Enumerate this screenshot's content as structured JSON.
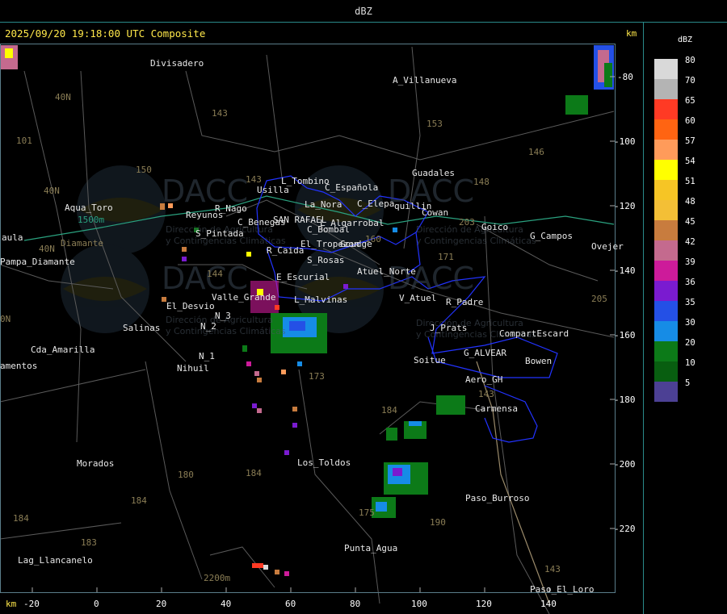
{
  "window": {
    "title": "dBZ"
  },
  "plot": {
    "header": "2025/09/20 19:18:00 UTC Composite",
    "y_unit": "km",
    "x_unit": "km",
    "y_ticks": [
      "-80",
      "-100",
      "-120",
      "-140",
      "-160",
      "-180",
      "-200",
      "-220"
    ],
    "x_ticks": [
      "-20",
      "0",
      "20",
      "40",
      "60",
      "80",
      "100",
      "120",
      "140"
    ]
  },
  "places": [
    {
      "id": "divisadero",
      "label": "Divisadero"
    },
    {
      "id": "a-villanueva",
      "label": "A_Villanueva"
    },
    {
      "id": "guadales",
      "label": "Guadales"
    },
    {
      "id": "l-tombino",
      "label": "L_Tombino"
    },
    {
      "id": "usilla",
      "label": "Usilla"
    },
    {
      "id": "c-espanola",
      "label": "C_Española"
    },
    {
      "id": "aqua-toro",
      "label": "Aqua_Toro"
    },
    {
      "id": "c-elepa",
      "label": "C_Elepa"
    },
    {
      "id": "quillin",
      "label": "quillin"
    },
    {
      "id": "cowan",
      "label": "Cowan"
    },
    {
      "id": "r-nago",
      "label": "R_Nago"
    },
    {
      "id": "reyunos",
      "label": "Reyunos"
    },
    {
      "id": "c-benegas",
      "label": "C_Benegas"
    },
    {
      "id": "san-rafael",
      "label": "SAN RAFAEL"
    },
    {
      "id": "la-nora",
      "label": "La_Nora"
    },
    {
      "id": "l-algarrobal",
      "label": "L_Algarrobal"
    },
    {
      "id": "goico",
      "label": "Goico"
    },
    {
      "id": "g-campos",
      "label": "G_Campos"
    },
    {
      "id": "ovejer",
      "label": "Ovejer"
    },
    {
      "id": "c-bombal",
      "label": "C_Bombal"
    },
    {
      "id": "s-pintada",
      "label": "S_Pintada"
    },
    {
      "id": "aula",
      "label": "aula"
    },
    {
      "id": "el-tropezon",
      "label": "El_Tropezon"
    },
    {
      "id": "goudge",
      "label": "Goudge"
    },
    {
      "id": "r-caida",
      "label": "R_Caida"
    },
    {
      "id": "pampa-diamante",
      "label": "Pampa_Diamante"
    },
    {
      "id": "s-rosas",
      "label": "S_Rosas"
    },
    {
      "id": "atuel-norte",
      "label": "Atuel_Norte"
    },
    {
      "id": "e-escurial",
      "label": "E_Escurial"
    },
    {
      "id": "valle-grande",
      "label": "Valle_Grande"
    },
    {
      "id": "v-atuel",
      "label": "V_Atuel"
    },
    {
      "id": "r-padre",
      "label": "R_Padre"
    },
    {
      "id": "el-desvio",
      "label": "El_Desvio"
    },
    {
      "id": "l-malvinas",
      "label": "L_Malvinas"
    },
    {
      "id": "n-3",
      "label": "N_3"
    },
    {
      "id": "n-2",
      "label": "N_2"
    },
    {
      "id": "salinas",
      "label": "Salinas"
    },
    {
      "id": "j-prats",
      "label": "J_Prats"
    },
    {
      "id": "compart-escard",
      "label": "CompartEscard"
    },
    {
      "id": "cda-amarilla",
      "label": "Cda_Amarilla"
    },
    {
      "id": "g-alvear",
      "label": "G_ALVEAR"
    },
    {
      "id": "n-1",
      "label": "N_1"
    },
    {
      "id": "soitue",
      "label": "Soitue"
    },
    {
      "id": "bowen",
      "label": "Bowen"
    },
    {
      "id": "amentos",
      "label": "amentos"
    },
    {
      "id": "nihuil",
      "label": "Nihuil"
    },
    {
      "id": "aero-gh",
      "label": "Aero_GH"
    },
    {
      "id": "carmensa",
      "label": "Carmensa"
    },
    {
      "id": "morados",
      "label": "Morados"
    },
    {
      "id": "los-toldos",
      "label": "Los_Toldos"
    },
    {
      "id": "paso-burroso",
      "label": "Paso_Burroso"
    },
    {
      "id": "punta-agua",
      "label": "Punta_Agua"
    },
    {
      "id": "lag-llancanelo",
      "label": "Lag_Llancanelo"
    },
    {
      "id": "paso-el-loro",
      "label": "Paso_El_Loro"
    },
    {
      "id": "elev-1500",
      "label": "1500m"
    },
    {
      "id": "elev-2200",
      "label": "2200m"
    },
    {
      "id": "diamante-lab",
      "label": "Diamante"
    }
  ],
  "roads": [
    {
      "id": "r143a",
      "label": "143"
    },
    {
      "id": "r153",
      "label": "153"
    },
    {
      "id": "r146",
      "label": "146"
    },
    {
      "id": "r40a",
      "label": "40N"
    },
    {
      "id": "r101",
      "label": "101"
    },
    {
      "id": "r150",
      "label": "150"
    },
    {
      "id": "r143b",
      "label": "143"
    },
    {
      "id": "r148",
      "label": "148"
    },
    {
      "id": "r40b",
      "label": "40N"
    },
    {
      "id": "r203",
      "label": "203"
    },
    {
      "id": "r40c",
      "label": "40N"
    },
    {
      "id": "r171",
      "label": "171"
    },
    {
      "id": "r144",
      "label": "144"
    },
    {
      "id": "r160",
      "label": "160"
    },
    {
      "id": "r205",
      "label": "205"
    },
    {
      "id": "r40d",
      "label": "0N"
    },
    {
      "id": "r173",
      "label": "173"
    },
    {
      "id": "r143c",
      "label": "143"
    },
    {
      "id": "r184a",
      "label": "184"
    },
    {
      "id": "r180",
      "label": "180"
    },
    {
      "id": "r184b",
      "label": "184"
    },
    {
      "id": "r184c",
      "label": "184"
    },
    {
      "id": "r184d",
      "label": "184"
    },
    {
      "id": "r175",
      "label": "175"
    },
    {
      "id": "r190",
      "label": "190"
    },
    {
      "id": "r183",
      "label": "183"
    },
    {
      "id": "r143d",
      "label": "143"
    }
  ],
  "watermark": {
    "logo": "DACC",
    "line1": "Dirección de Agricultura",
    "line2": "y Contingencias Climáticas"
  },
  "legend": {
    "title": "dBZ",
    "entries": [
      {
        "value": "80",
        "color": "#d9d9d9"
      },
      {
        "value": "70",
        "color": "#b4b4b4"
      },
      {
        "value": "65",
        "color": "#ff3a24"
      },
      {
        "value": "60",
        "color": "#ff6412"
      },
      {
        "value": "57",
        "color": "#ff9b5a"
      },
      {
        "value": "54",
        "color": "#ffff00"
      },
      {
        "value": "51",
        "color": "#f6c525"
      },
      {
        "value": "48",
        "color": "#f3bf36"
      },
      {
        "value": "45",
        "color": "#c87c3e"
      },
      {
        "value": "42",
        "color": "#c46a8e"
      },
      {
        "value": "39",
        "color": "#cd1b9a"
      },
      {
        "value": "36",
        "color": "#7a1bd0"
      },
      {
        "value": "35",
        "color": "#2450e6"
      },
      {
        "value": "30",
        "color": "#168ce6"
      },
      {
        "value": "20",
        "color": "#0c7a18"
      },
      {
        "value": "10",
        "color": "#085e10"
      },
      {
        "value": "5",
        "color": "#4c4094"
      }
    ]
  },
  "colors": {
    "axis_label": "#ffe84a",
    "frame": "#2a8a8a",
    "boundary": "#2233ff",
    "river": "#2aa17f",
    "road": "#8a7d55"
  }
}
